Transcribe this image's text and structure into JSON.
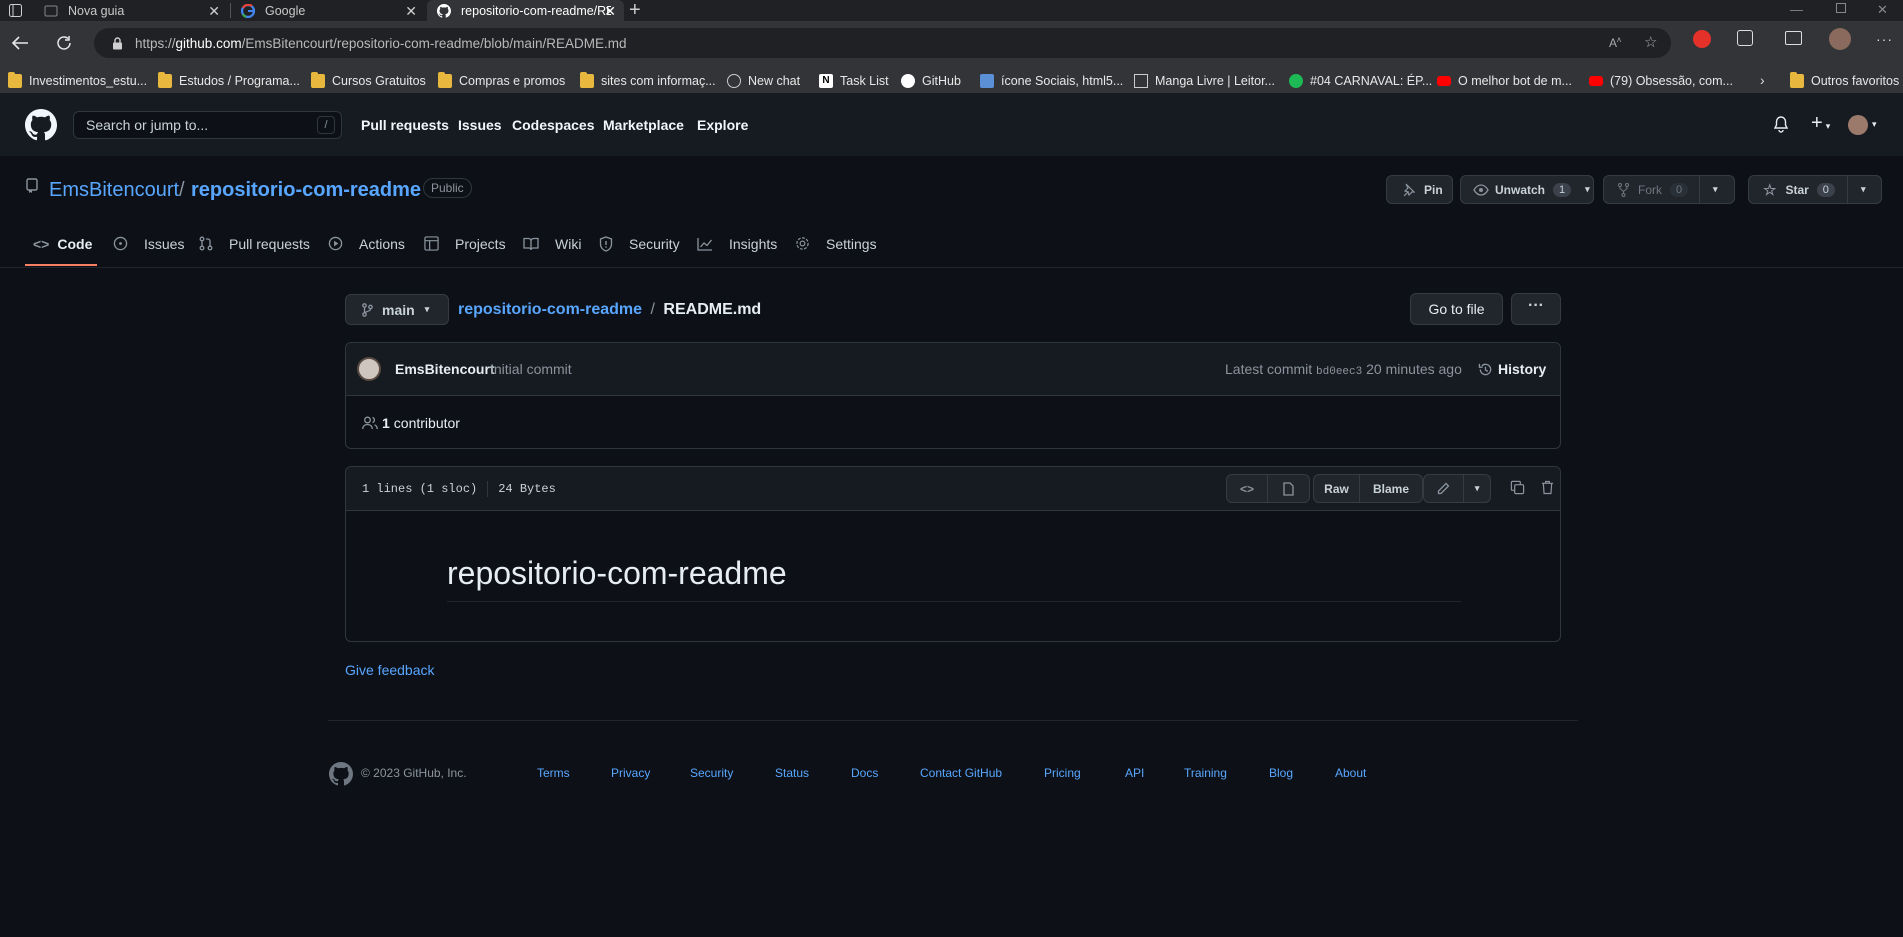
{
  "browser": {
    "tabs": [
      {
        "title": "Nova guia"
      },
      {
        "title": "Google"
      },
      {
        "title": "repositorio-com-readme/READM"
      }
    ],
    "url": {
      "scheme": "https://",
      "host": "github.com",
      "path": "/EmsBitencourt/repositorio-com-readme/blob/main/README.md"
    },
    "bookmarks": [
      {
        "label": "Investimentos_estu...",
        "icon": "folder-icon"
      },
      {
        "label": "Estudos / Programa...",
        "icon": "folder-icon"
      },
      {
        "label": "Cursos Gratuitos",
        "icon": "folder-icon"
      },
      {
        "label": "Compras e promos",
        "icon": "folder-icon"
      },
      {
        "label": "sites com informaç...",
        "icon": "folder-icon"
      },
      {
        "label": "New chat",
        "icon": "chatgpt-icon"
      },
      {
        "label": "Task List",
        "icon": "notion-icon"
      },
      {
        "label": "GitHub",
        "icon": "github-icon"
      },
      {
        "label": "ícone Sociais, html5...",
        "icon": "site-icon"
      },
      {
        "label": "Manga Livre | Leitor...",
        "icon": "manga-icon"
      },
      {
        "label": "#04 CARNAVAL: ÉP...",
        "icon": "spotify-icon"
      },
      {
        "label": "O melhor bot de m...",
        "icon": "youtube-icon"
      },
      {
        "label": "(79) Obsessão, com...",
        "icon": "youtube-icon"
      }
    ],
    "other_favorites": "Outros favoritos"
  },
  "header": {
    "search_placeholder": "Search or jump to...",
    "search_shortcut": "/",
    "nav": [
      "Pull requests",
      "Issues",
      "Codespaces",
      "Marketplace",
      "Explore"
    ]
  },
  "repo": {
    "owner": "EmsBitencourt",
    "separator": "/",
    "name": "repositorio-com-readme",
    "visibility": "Public",
    "pin_label": "Pin",
    "unwatch_label": "Unwatch",
    "unwatch_count": "1",
    "fork_label": "Fork",
    "fork_count": "0",
    "star_label": "Star",
    "star_count": "0",
    "tabs": [
      "Code",
      "Issues",
      "Pull requests",
      "Actions",
      "Projects",
      "Wiki",
      "Security",
      "Insights",
      "Settings"
    ],
    "active_tab": "Code"
  },
  "file": {
    "branch": "main",
    "breadcrumb_repo": "repositorio-com-readme",
    "breadcrumb_sep": "/",
    "filename": "README.md",
    "goto_label": "Go to file",
    "more_label": "···",
    "commit": {
      "author": "EmsBitencourt",
      "message": "Initial commit",
      "latest_label": "Latest commit",
      "sha": "bd0eec3",
      "time": "20 minutes ago",
      "history_label": "History"
    },
    "contributors_count": "1",
    "contributors_label": "contributor",
    "stats_lines": "1 lines (1 sloc)",
    "stats_size": "24 Bytes",
    "raw_label": "Raw",
    "blame_label": "Blame",
    "readme_heading": "repositorio-com-readme"
  },
  "feedback_label": "Give feedback",
  "footer": {
    "copyright": "© 2023 GitHub, Inc.",
    "links": [
      "Terms",
      "Privacy",
      "Security",
      "Status",
      "Docs",
      "Contact GitHub",
      "Pricing",
      "API",
      "Training",
      "Blog",
      "About"
    ]
  },
  "colors": {
    "page_bg": "#0d1117",
    "header_bg": "#161b22",
    "link": "#58a6ff",
    "active_tab_underline": "#f78166",
    "border": "#30363d"
  }
}
